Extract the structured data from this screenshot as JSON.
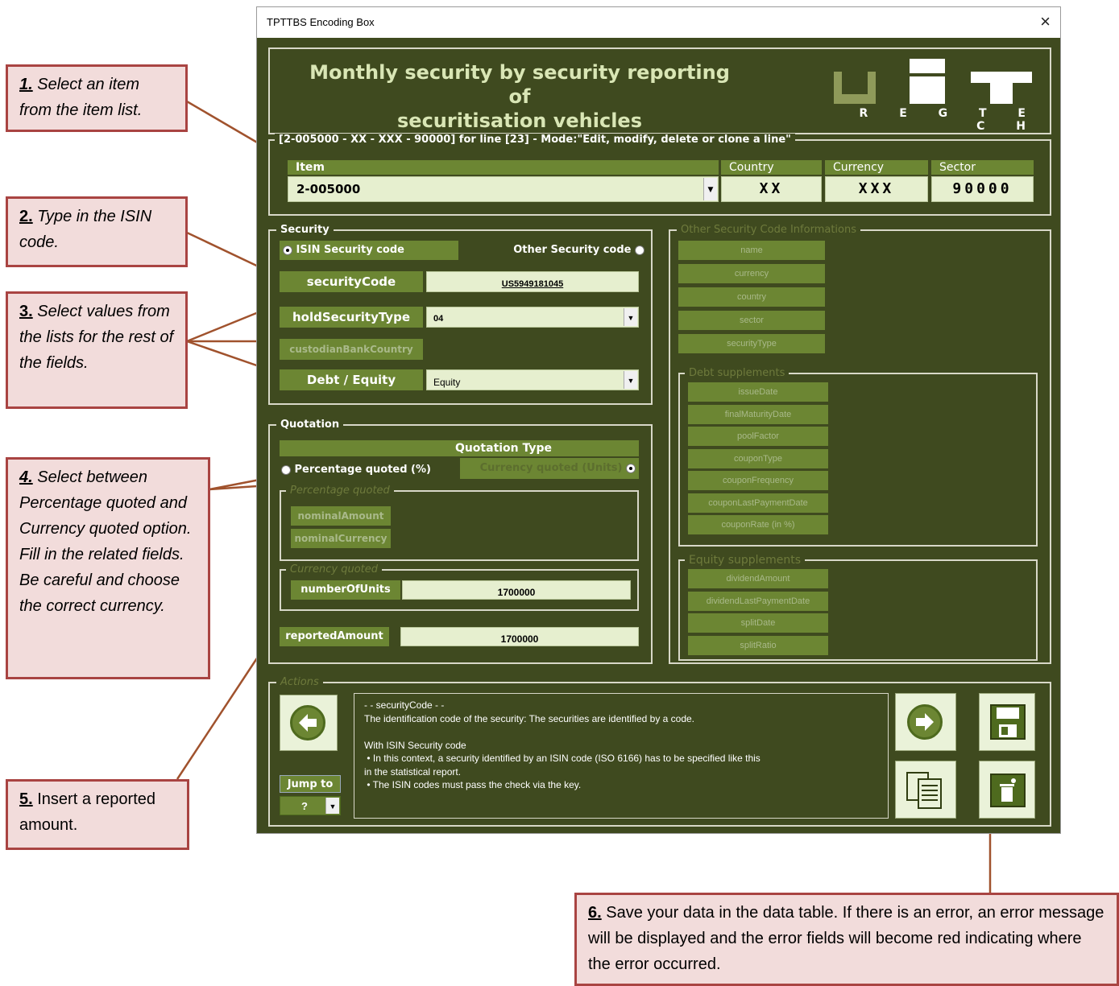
{
  "window": {
    "title": "TPTTBS Encoding Box",
    "close_glyph": "×"
  },
  "header": {
    "title_line1": "Monthly security by security reporting of",
    "title_line2": "securitisation vehicles",
    "logo_subtitle": "R E G T E C H"
  },
  "line_section": {
    "legend": "[2-005000 - XX - XXX - 90000] for line [23] - Mode:\"Edit, modify, delete or clone a line\"",
    "item_header": "Item",
    "item_value": "2-005000",
    "country_header": "Country",
    "country_value": "XX",
    "currency_header": "Currency",
    "currency_value": "XXX",
    "sector_header": "Sector",
    "sector_value": "90000"
  },
  "security": {
    "legend": "Security",
    "isin_label": "ISIN Security code",
    "other_label": "Other Security code",
    "security_code_label": "securityCode",
    "security_code_value": "US5949181045",
    "hold_type_label": "holdSecurityType",
    "hold_type_value": "04",
    "custodian_label": "custodianBankCountry",
    "debt_equity_label": "Debt / Equity",
    "debt_equity_value": "Equity"
  },
  "quotation": {
    "legend": "Quotation",
    "type_header": "Quotation Type",
    "percentage_label": "Percentage quoted  (%)",
    "currency_label": "Currency quoted  (Units)",
    "percentage_legend": "Percentage quoted",
    "nominal_amount_label": "nominalAmount",
    "nominal_currency_label": "nominalCurrency",
    "currency_legend": "Currency quoted",
    "units_label": "numberOfUnits",
    "units_value": "1700000",
    "reported_label": "reportedAmount",
    "reported_value": "1700000"
  },
  "other_info": {
    "legend": "Other Security Code Informations",
    "fields": [
      "name",
      "currency",
      "country",
      "sector",
      "securityType"
    ],
    "debt_legend": "Debt supplements",
    "debt_fields": [
      "issueDate",
      "finalMaturityDate",
      "poolFactor",
      "couponType",
      "couponFrequency",
      "couponLastPaymentDate",
      "couponRate (in %)"
    ],
    "equity_legend": "Equity supplements",
    "equity_fields": [
      "dividendAmount",
      "dividendLastPaymentDate",
      "splitDate",
      "splitRatio"
    ]
  },
  "actions": {
    "legend": "Actions",
    "jump_label": "Jump to",
    "jump_value": "?",
    "help_lines": [
      "- - securityCode - -",
      "The identification code of the security: The securities are identified by a code.",
      "",
      "With ISIN Security code",
      " • In this context, a security identified by an ISIN code (ISO 6166) has to be specified like this",
      "in the statistical report.",
      " • The ISIN codes must pass the check via the key."
    ]
  },
  "callouts": {
    "c1_num": "1.",
    "c1_text": " Select an item from the item list.",
    "c2_num": "2.",
    "c2_text": " Type in the ISIN code.",
    "c3_num": "3.",
    "c3_text": " Select values from the lists for the rest of the fields.",
    "c4_num": "4.",
    "c4_text": " Select between Percentage quoted and Currency quoted option. Fill in the related fields. Be careful and choose the correct currency.",
    "c5_num": "5.",
    "c5_text": " Insert a reported amount.",
    "c6_num": "6.",
    "c6_text": " Save your data in the data table. If there is an error, an error message will be displayed and the error fields will become red indicating where the error occurred."
  }
}
